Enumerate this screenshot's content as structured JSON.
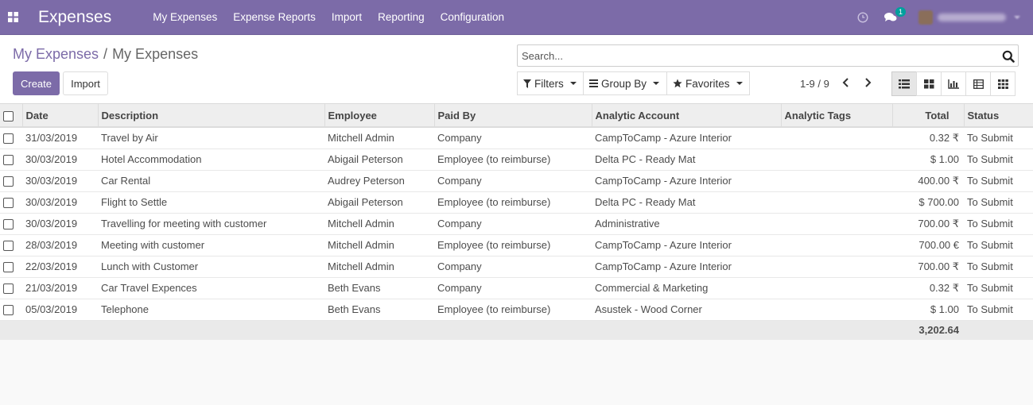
{
  "app": {
    "title": "Expenses"
  },
  "menu": [
    "My Expenses",
    "Expense Reports",
    "Import",
    "Reporting",
    "Configuration"
  ],
  "nav": {
    "messages_count": "1"
  },
  "breadcrumb": {
    "parent": "My Expenses",
    "separator": "/",
    "current": "My Expenses"
  },
  "buttons": {
    "create": "Create",
    "import": "Import"
  },
  "search": {
    "placeholder": "Search...",
    "value": ""
  },
  "filters": {
    "filters": "Filters",
    "group_by": "Group By",
    "favorites": "Favorites"
  },
  "pager": {
    "range": "1-9 / 9"
  },
  "colors": {
    "brand": "#7c6ba8",
    "badge": "#00a09d"
  },
  "table": {
    "headers": [
      "Date",
      "Description",
      "Employee",
      "Paid By",
      "Analytic Account",
      "Analytic Tags",
      "Total",
      "Status"
    ],
    "rows": [
      [
        "31/03/2019",
        "Travel by Air",
        "Mitchell Admin",
        "Company",
        "CampToCamp - Azure Interior",
        "",
        "0.32 ₹",
        "To Submit"
      ],
      [
        "30/03/2019",
        "Hotel Accommodation",
        "Abigail Peterson",
        "Employee (to reimburse)",
        "Delta PC - Ready Mat",
        "",
        "$ 1.00",
        "To Submit"
      ],
      [
        "30/03/2019",
        "Car Rental",
        "Audrey Peterson",
        "Company",
        "CampToCamp - Azure Interior",
        "",
        "400.00 ₹",
        "To Submit"
      ],
      [
        "30/03/2019",
        "Flight to Settle",
        "Abigail Peterson",
        "Employee (to reimburse)",
        "Delta PC - Ready Mat",
        "",
        "$ 700.00",
        "To Submit"
      ],
      [
        "30/03/2019",
        "Travelling for meeting with customer",
        "Mitchell Admin",
        "Company",
        "Administrative",
        "",
        "700.00 ₹",
        "To Submit"
      ],
      [
        "28/03/2019",
        "Meeting with customer",
        "Mitchell Admin",
        "Employee (to reimburse)",
        "CampToCamp - Azure Interior",
        "",
        "700.00 €",
        "To Submit"
      ],
      [
        "22/03/2019",
        "Lunch with Customer",
        "Mitchell Admin",
        "Company",
        "CampToCamp - Azure Interior",
        "",
        "700.00 ₹",
        "To Submit"
      ],
      [
        "21/03/2019",
        "Car Travel Expences",
        "Beth Evans",
        "Company",
        "Commercial & Marketing",
        "",
        "0.32 ₹",
        "To Submit"
      ],
      [
        "05/03/2019",
        "Telephone",
        "Beth Evans",
        "Employee (to reimburse)",
        "Asustek - Wood Corner",
        "",
        "$ 1.00",
        "To Submit"
      ]
    ],
    "footer_total": "3,202.64"
  }
}
